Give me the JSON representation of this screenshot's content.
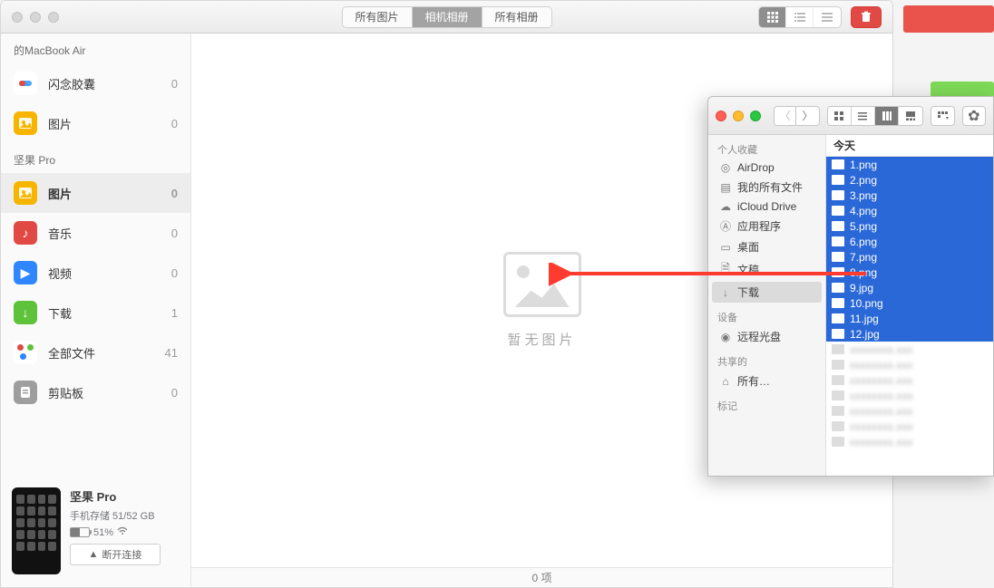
{
  "app": {
    "tabs": [
      "所有图片",
      "相机相册",
      "所有相册"
    ],
    "active_tab_index": 1,
    "trash_title": "删除"
  },
  "sidebar": {
    "sections": [
      {
        "title": "的MacBook Air",
        "items": [
          {
            "label": "闪念胶囊",
            "count": 0,
            "icon": "capsule"
          },
          {
            "label": "图片",
            "count": 0,
            "icon": "photos-orange"
          }
        ]
      },
      {
        "title": "坚果 Pro",
        "items": [
          {
            "label": "图片",
            "count": 0,
            "icon": "photos-orange",
            "selected": true
          },
          {
            "label": "音乐",
            "count": 0,
            "icon": "music-red"
          },
          {
            "label": "视频",
            "count": 0,
            "icon": "video-blue"
          },
          {
            "label": "下载",
            "count": 1,
            "icon": "download-green"
          },
          {
            "label": "全部文件",
            "count": 41,
            "icon": "all-multi"
          },
          {
            "label": "剪贴板",
            "count": 0,
            "icon": "clipboard-grey"
          }
        ]
      }
    ]
  },
  "device": {
    "name": "坚果 Pro",
    "storage": "手机存储 51/52 GB",
    "battery_pct": "51%",
    "disconnect": "断开连接"
  },
  "main": {
    "empty_text": "暂无图片",
    "status": "0 项"
  },
  "finder": {
    "side": {
      "favorites_head": "个人收藏",
      "favorites": [
        "AirDrop",
        "我的所有文件",
        "iCloud Drive",
        "应用程序",
        "桌面",
        "文稿",
        "下载"
      ],
      "selected_favorite": "下载",
      "devices_head": "设备",
      "devices": [
        "远程光盘"
      ],
      "shared_head": "共享的",
      "shared": [
        "所有…"
      ],
      "tags_head": "标记"
    },
    "list": {
      "group_head": "今天",
      "selected": [
        "1.png",
        "2.png",
        "3.png",
        "4.png",
        "5.png",
        "6.png",
        "7.png",
        "8.png",
        "9.jpg",
        "10.png",
        "11.jpg",
        "12.jpg"
      ],
      "other_count": 7
    }
  }
}
